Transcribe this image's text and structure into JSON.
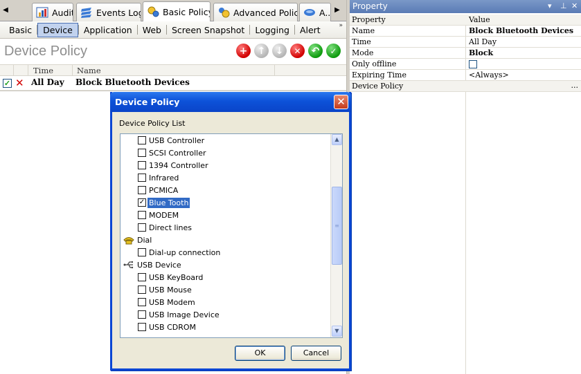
{
  "tabs": {
    "left_arrow": "◀",
    "right_arrow": "▶",
    "items": [
      {
        "label": "Audit"
      },
      {
        "label": "Events Log"
      },
      {
        "label": "Basic Policy"
      },
      {
        "label": "Advanced Policy"
      },
      {
        "label": "A..."
      }
    ]
  },
  "submenu": {
    "items": [
      "Basic",
      "Device",
      "Application",
      "Web",
      "Screen Snapshot",
      "Logging",
      "Alert"
    ],
    "active": "Device",
    "more": "»"
  },
  "policy": {
    "title": "Device Policy",
    "columns": {
      "time": "Time",
      "name": "Name"
    },
    "row": {
      "time": "All Day",
      "name": "Block Bluetooth Devices",
      "enabled": true,
      "blocked_mark": "✕",
      "check_mark": "✓"
    }
  },
  "toolbar_icons": [
    "add-icon",
    "up-arrow-icon",
    "down-arrow-icon",
    "delete-icon",
    "undo-icon",
    "apply-icon"
  ],
  "property": {
    "title": "Property",
    "controls": {
      "dropdown": "▾",
      "pin": "⊥",
      "close": "✕"
    },
    "header": {
      "key": "Property",
      "value": "Value"
    },
    "rows": [
      {
        "key": "Name",
        "value": "Block Bluetooth Devices",
        "bold": true
      },
      {
        "key": "Time",
        "value": "All Day",
        "bold": false
      },
      {
        "key": "Mode",
        "value": "Block",
        "bold": true
      },
      {
        "key": "Only offline",
        "value": "",
        "checkbox": true
      },
      {
        "key": "Expiring Time",
        "value": "<Always>",
        "bold": false
      },
      {
        "key": "Device Policy",
        "value": "",
        "ellipsis": "..."
      }
    ]
  },
  "dialog": {
    "title": "Device Policy",
    "close": "✕",
    "list_label": "Device Policy List",
    "items": [
      {
        "type": "check",
        "label": "USB Controller",
        "checked": false
      },
      {
        "type": "check",
        "label": "SCSI Controller",
        "checked": false
      },
      {
        "type": "check",
        "label": "1394 Controller",
        "checked": false
      },
      {
        "type": "check",
        "label": "Infrared",
        "checked": false
      },
      {
        "type": "check",
        "label": "PCMICA",
        "checked": false
      },
      {
        "type": "check",
        "label": "Blue Tooth",
        "checked": true,
        "selected": true
      },
      {
        "type": "check",
        "label": "MODEM",
        "checked": false
      },
      {
        "type": "check",
        "label": "Direct lines",
        "checked": false
      },
      {
        "type": "group",
        "label": "Dial",
        "icon": "dial-phone-icon"
      },
      {
        "type": "check",
        "label": "Dial-up connection",
        "checked": false
      },
      {
        "type": "group",
        "label": "USB Device",
        "icon": "usb-icon"
      },
      {
        "type": "check",
        "label": "USB KeyBoard",
        "checked": false
      },
      {
        "type": "check",
        "label": "USB Mouse",
        "checked": false
      },
      {
        "type": "check",
        "label": "USB Modem",
        "checked": false
      },
      {
        "type": "check",
        "label": "USB Image Device",
        "checked": false
      },
      {
        "type": "check",
        "label": "USB CDROM",
        "checked": false
      }
    ],
    "scroll_up": "▲",
    "scroll_down": "▼",
    "scroll_thumb": "≡",
    "ok_label": "OK",
    "cancel_label": "Cancel"
  }
}
